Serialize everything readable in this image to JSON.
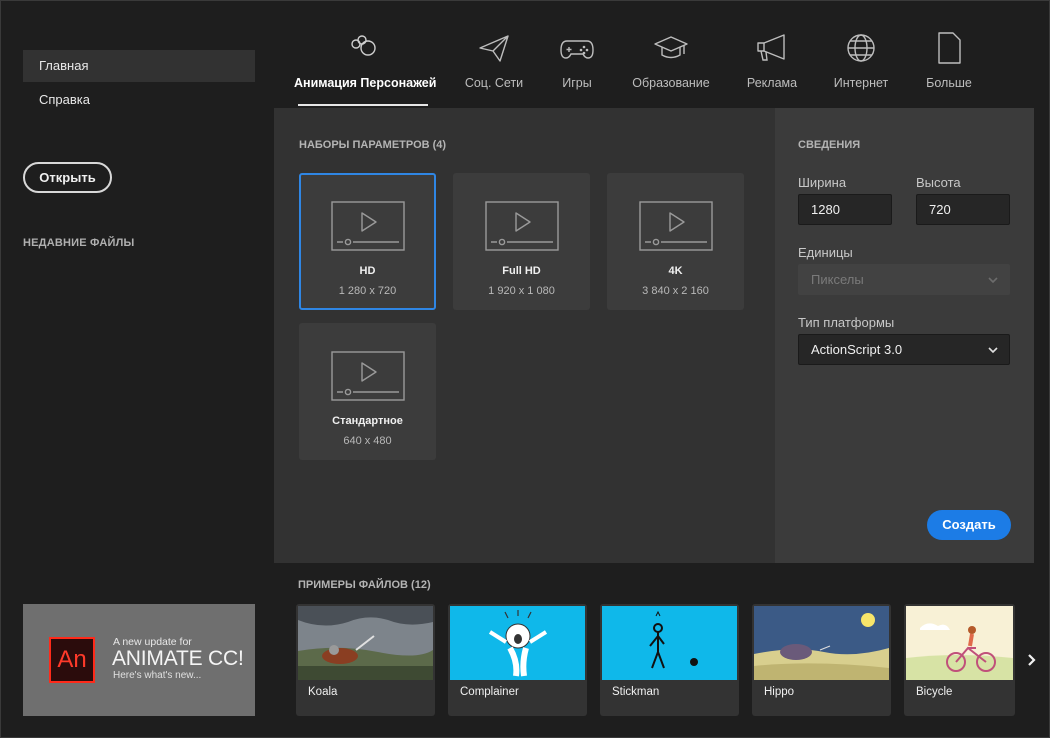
{
  "sidebar": {
    "items": [
      {
        "label": "Главная",
        "active": true
      },
      {
        "label": "Справка",
        "active": false
      }
    ],
    "open_label": "Открыть",
    "recent_title": "НЕДАВНИЕ ФАЙЛЫ",
    "promo": {
      "logo": "An",
      "line1": "A new update for",
      "line2": "ANIMATE CC!",
      "line3": "Here's what's new..."
    }
  },
  "categories": [
    {
      "label": "Анимация Персонажей",
      "icon": "character-animation-icon",
      "active": true
    },
    {
      "label": "Соц. Сети",
      "icon": "paper-plane-icon"
    },
    {
      "label": "Игры",
      "icon": "gamepad-icon"
    },
    {
      "label": "Образование",
      "icon": "graduation-cap-icon"
    },
    {
      "label": "Реклама",
      "icon": "megaphone-icon"
    },
    {
      "label": "Интернет",
      "icon": "globe-icon"
    },
    {
      "label": "Больше",
      "icon": "document-icon"
    }
  ],
  "presets": {
    "title": "НАБОРЫ ПАРАМЕТРОВ (4)",
    "items": [
      {
        "name": "HD",
        "size": "1 280 x 720",
        "selected": true
      },
      {
        "name": "Full HD",
        "size": "1 920 x 1 080"
      },
      {
        "name": "4K",
        "size": "3 840 x 2 160"
      },
      {
        "name": "Стандартное",
        "size": "640 x 480"
      }
    ]
  },
  "details": {
    "title": "СВЕДЕНИЯ",
    "width_label": "Ширина",
    "width_value": "1280",
    "height_label": "Высота",
    "height_value": "720",
    "units_label": "Единицы",
    "units_value": "Пикселы",
    "platform_label": "Тип платформы",
    "platform_value": "ActionScript 3.0",
    "create_label": "Создать"
  },
  "samples": {
    "title": "ПРИМЕРЫ ФАЙЛОВ (12)",
    "items": [
      {
        "name": "Koala"
      },
      {
        "name": "Complainer"
      },
      {
        "name": "Stickman"
      },
      {
        "name": "Hippo"
      },
      {
        "name": "Bicycle"
      }
    ]
  },
  "colors": {
    "accent": "#1c7ce6",
    "selected_border": "#2f86e4",
    "background": "#1e1e1e"
  }
}
